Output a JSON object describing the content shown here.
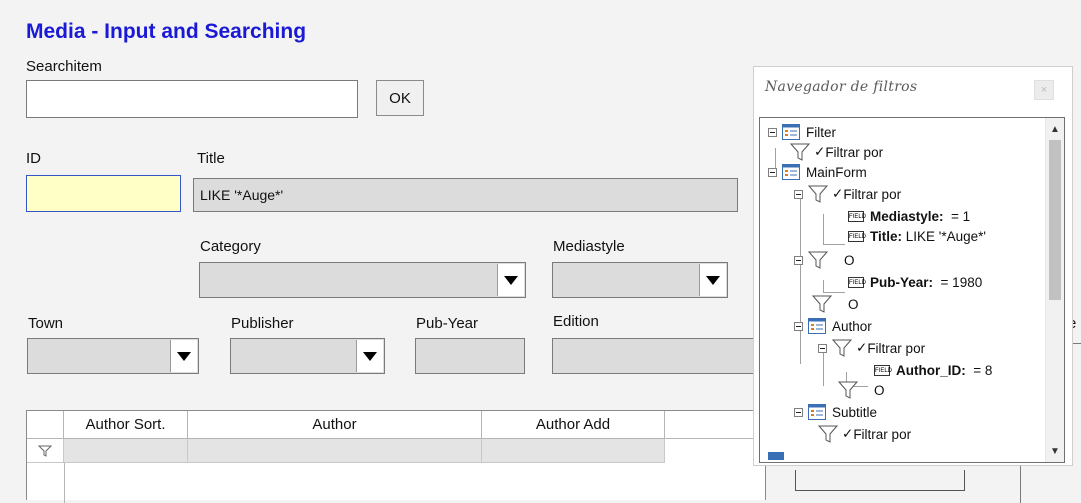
{
  "form": {
    "title": "Media - Input and Searching",
    "searchitem_label": "Searchitem",
    "searchitem_value": "",
    "ok_label": "OK",
    "id_label": "ID",
    "id_value": "",
    "title_label": "Title",
    "title_value": "LIKE '*Auge*'",
    "category_label": "Category",
    "mediastyle_label": "Mediastyle",
    "town_label": "Town",
    "publisher_label": "Publisher",
    "pubyear_label": "Pub-Year",
    "edition_label": "Edition",
    "partial_right_label": "e"
  },
  "grid": {
    "columns": [
      "Author Sort.",
      "Author",
      "Author Add"
    ],
    "filter_row_icon": "funnel-icon"
  },
  "navigator": {
    "title": "Navegador de filtros",
    "close_label": "×",
    "tree": {
      "filter_form": "Filter",
      "filter_by_1": "Filtrar por",
      "main_form": "MainForm",
      "filter_by_2": "Filtrar por",
      "mediastyle_name": "Mediastyle:",
      "mediastyle_cond": "= 1",
      "title_name": "Title:",
      "title_cond": "LIKE '*Auge*'",
      "or_1": "O",
      "pubyear_name": "Pub-Year:",
      "pubyear_cond": "= 1980",
      "or_2": "O",
      "author_form": "Author",
      "filter_by_3": "Filtrar por",
      "authorid_name": "Author_ID:",
      "authorid_cond": "= 8",
      "or_3": "O",
      "subtitle_form": "Subtitle",
      "filter_by_4": "Filtrar por"
    }
  },
  "colors": {
    "title": "#1a1ad6",
    "id_field_bg": "#ffffc6",
    "disabled_field_bg": "#dcdcdc"
  }
}
